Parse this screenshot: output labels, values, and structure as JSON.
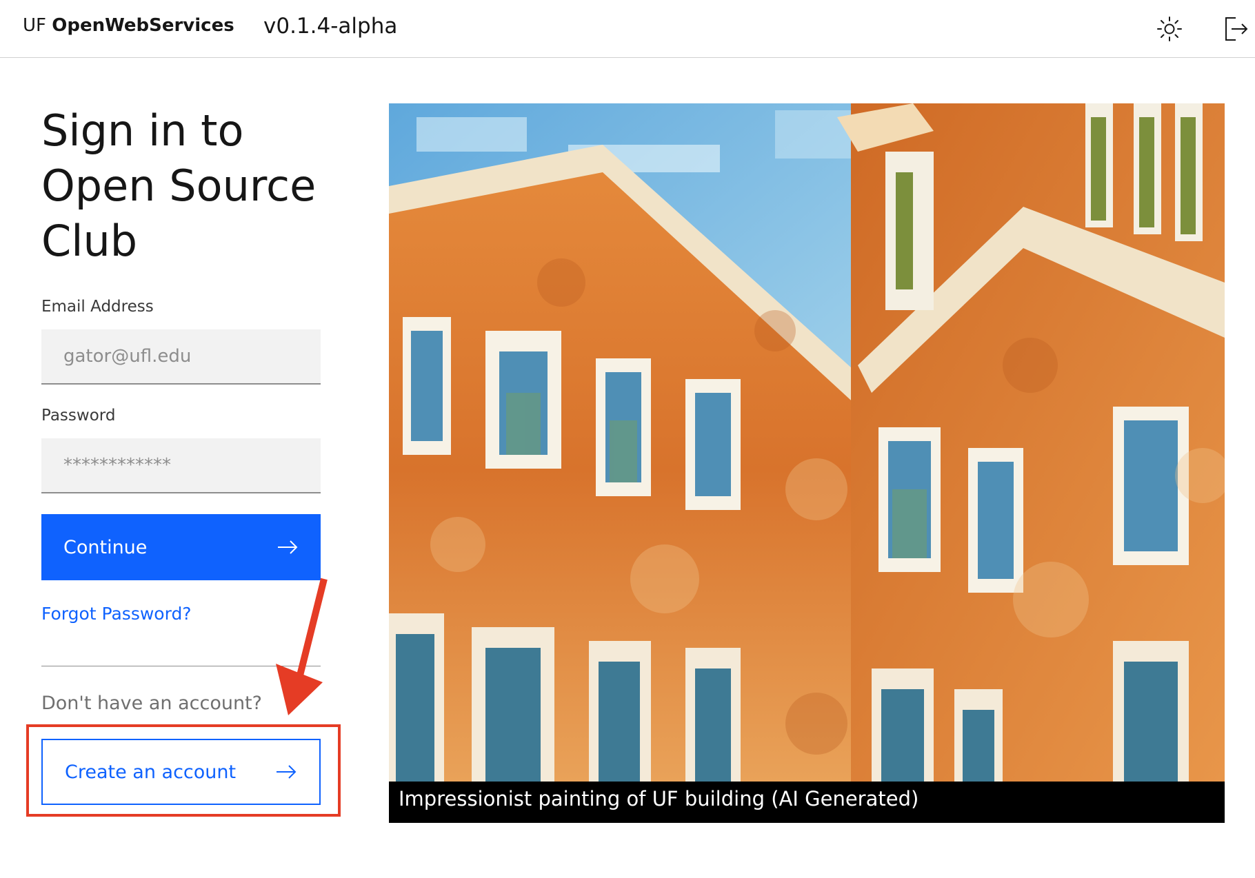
{
  "header": {
    "brand_prefix": "UF",
    "brand_name": "OpenWebServices",
    "version": "v0.1.4-alpha",
    "icons": [
      "theme-toggle-icon",
      "logout-icon"
    ]
  },
  "login": {
    "title": "Sign in to Open Source Club",
    "email_label": "Email Address",
    "email_placeholder": "gator@ufl.edu",
    "password_label": "Password",
    "password_placeholder": "************",
    "continue_label": "Continue",
    "forgot_label": "Forgot Password?",
    "no_account_text": "Don't have an account?",
    "create_label": "Create an account"
  },
  "image": {
    "caption": "Impressionist painting of UF building (AI Generated)"
  },
  "colors": {
    "primary": "#0f62fe",
    "annotation": "#e53c25",
    "painting_orange": "#d9762f",
    "sky": "#6fb3dd"
  }
}
